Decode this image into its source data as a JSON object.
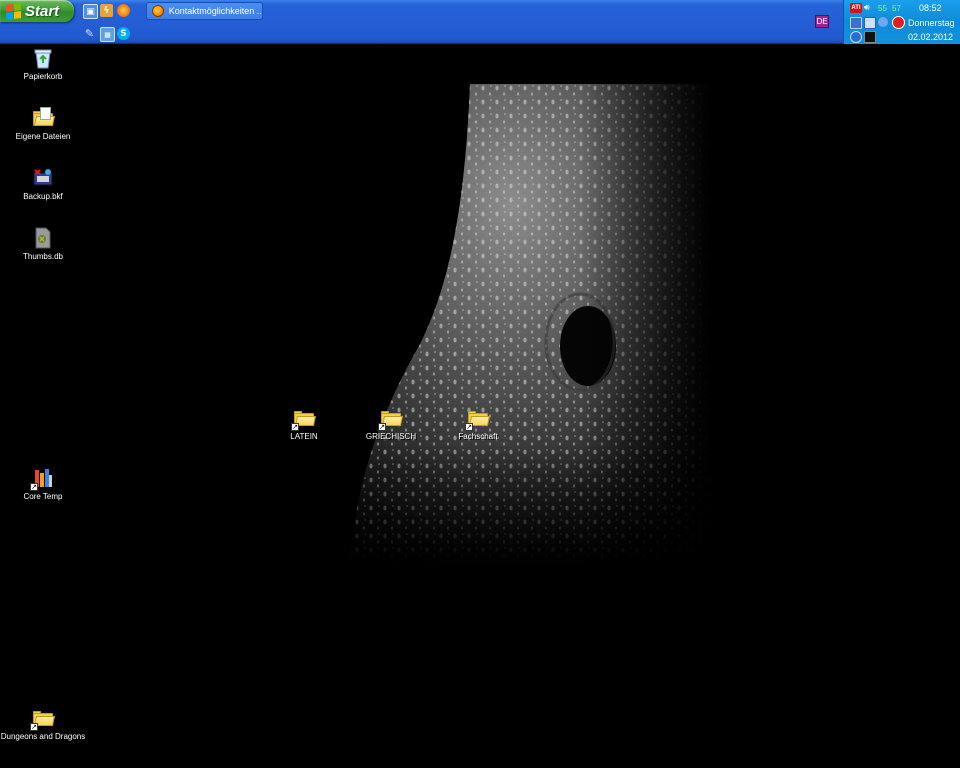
{
  "taskbar": {
    "start_label": "Start",
    "quicklaunch": [
      {
        "icon": "show-desktop-icon",
        "color": "#4f8fe6"
      },
      {
        "icon": "winamp-icon",
        "color": "#e9a23a"
      },
      {
        "icon": "firefox-icon",
        "color": "#f07d1a"
      },
      {
        "icon": "pen-tool-icon",
        "color": "#6b8fc7"
      },
      {
        "icon": "network-icon",
        "color": "#5ea0e6"
      },
      {
        "icon": "skype-icon",
        "color": "#00aff0"
      }
    ],
    "task_button_label": "Kontaktmöglichkeiten ...",
    "language": "DE"
  },
  "tray": {
    "temp1": "55",
    "temp2": "57",
    "time": "08:52",
    "weekday": "Donnerstag",
    "date": "02.02.2012",
    "ati_label": "ATI"
  },
  "desktop": {
    "recycle_bin": "Papierkorb",
    "my_documents": "Eigene Dateien",
    "backup": "Backup.bkf",
    "thumbs": "Thumbs.db",
    "core_temp": "Core Temp",
    "dnd": "Dungeons and Dragons",
    "latein": "LATEIN",
    "griechisch": "GRIECHISCH",
    "fachschaft": "Fachschaft"
  },
  "colors": {
    "taskbar_blue": "#245ed5",
    "tray_blue": "#0f8ad7",
    "start_green": "#3c9a33",
    "desktop_bg": "#000000"
  }
}
